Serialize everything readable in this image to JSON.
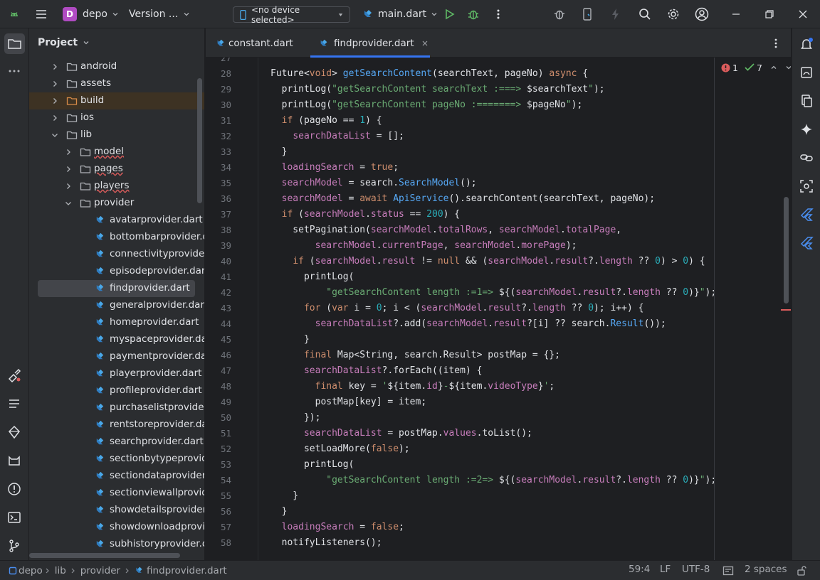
{
  "topbar": {
    "project_initial": "D",
    "project_name": "depo",
    "version_label": "Version ...",
    "device_selector": "<no device selected>",
    "run_config": "main.dart"
  },
  "sidebar": {
    "title": "Project"
  },
  "tree": [
    {
      "label": "android",
      "type": "folder",
      "indent": 0,
      "state": "closed"
    },
    {
      "label": "assets",
      "type": "folder",
      "indent": 0,
      "state": "closed"
    },
    {
      "label": "build",
      "type": "folder-excluded",
      "indent": 0,
      "state": "closed"
    },
    {
      "label": "ios",
      "type": "folder",
      "indent": 0,
      "state": "closed"
    },
    {
      "label": "lib",
      "type": "folder",
      "indent": 0,
      "state": "open"
    },
    {
      "label": "model",
      "type": "folder",
      "indent": 1,
      "state": "closed"
    },
    {
      "label": "pages",
      "type": "folder",
      "indent": 1,
      "state": "closed"
    },
    {
      "label": "players",
      "type": "folder",
      "indent": 1,
      "state": "closed"
    },
    {
      "label": "provider",
      "type": "folder",
      "indent": 1,
      "state": "open"
    },
    {
      "label": "avatarprovider.dart",
      "type": "file",
      "indent": 2
    },
    {
      "label": "bottombarprovider.dart",
      "type": "file",
      "indent": 2
    },
    {
      "label": "connectivityprovider.dart",
      "type": "file",
      "indent": 2
    },
    {
      "label": "episodeprovider.dart",
      "type": "file",
      "indent": 2
    },
    {
      "label": "findprovider.dart",
      "type": "file",
      "indent": 2,
      "selected": true
    },
    {
      "label": "generalprovider.dart",
      "type": "file",
      "indent": 2
    },
    {
      "label": "homeprovider.dart",
      "type": "file",
      "indent": 2
    },
    {
      "label": "myspaceprovider.dart",
      "type": "file",
      "indent": 2
    },
    {
      "label": "paymentprovider.dart",
      "type": "file",
      "indent": 2
    },
    {
      "label": "playerprovider.dart",
      "type": "file",
      "indent": 2
    },
    {
      "label": "profileprovider.dart",
      "type": "file",
      "indent": 2
    },
    {
      "label": "purchaselistprovider.dart",
      "type": "file",
      "indent": 2
    },
    {
      "label": "rentstoreprovider.dart",
      "type": "file",
      "indent": 2
    },
    {
      "label": "searchprovider.dart",
      "type": "file",
      "indent": 2
    },
    {
      "label": "sectionbytypeprovider.dart",
      "type": "file",
      "indent": 2
    },
    {
      "label": "sectiondataprovider.dart",
      "type": "file",
      "indent": 2
    },
    {
      "label": "sectionviewallprovider.dart",
      "type": "file",
      "indent": 2
    },
    {
      "label": "showdetailsprovider.dart",
      "type": "file",
      "indent": 2
    },
    {
      "label": "showdownloadprovider.dart",
      "type": "file",
      "indent": 2
    },
    {
      "label": "subhistoryprovider.dart",
      "type": "file",
      "indent": 2
    }
  ],
  "tabs": [
    {
      "label": "constant.dart",
      "active": false
    },
    {
      "label": "findprovider.dart",
      "active": true
    }
  ],
  "inspections": {
    "errors": "1",
    "warnings": "7"
  },
  "code_lines": [
    {
      "n": "27",
      "segs": []
    },
    {
      "n": "28",
      "segs": [
        [
          "t",
          "Future<"
        ],
        [
          "k",
          "void"
        ],
        [
          "t",
          "> "
        ],
        [
          "f",
          "getSearchContent"
        ],
        [
          "t",
          "(searchText, pageNo) "
        ],
        [
          "k",
          "async"
        ],
        [
          "t",
          " {"
        ]
      ]
    },
    {
      "n": "29",
      "segs": [
        [
          "t",
          "  printLog("
        ],
        [
          "s",
          "\"getSearchContent searchText :===> "
        ],
        [
          "t",
          "$searchText"
        ],
        [
          "s",
          "\""
        ],
        [
          "t",
          ");"
        ]
      ]
    },
    {
      "n": "30",
      "segs": [
        [
          "t",
          "  printLog("
        ],
        [
          "s",
          "\"getSearchContent pageNo :=======> "
        ],
        [
          "t",
          "$pageNo"
        ],
        [
          "s",
          "\""
        ],
        [
          "t",
          ");"
        ]
      ]
    },
    {
      "n": "31",
      "segs": [
        [
          "t",
          "  "
        ],
        [
          "k",
          "if"
        ],
        [
          "t",
          " (pageNo == "
        ],
        [
          "n",
          "1"
        ],
        [
          "t",
          ") {"
        ]
      ]
    },
    {
      "n": "32",
      "segs": [
        [
          "t",
          "    "
        ],
        [
          "p",
          "searchDataList"
        ],
        [
          "t",
          " = [];"
        ]
      ]
    },
    {
      "n": "33",
      "segs": [
        [
          "t",
          "  }"
        ]
      ]
    },
    {
      "n": "34",
      "segs": [
        [
          "t",
          "  "
        ],
        [
          "p",
          "loadingSearch"
        ],
        [
          "t",
          " = "
        ],
        [
          "k",
          "true"
        ],
        [
          "t",
          ";"
        ]
      ]
    },
    {
      "n": "35",
      "segs": [
        [
          "t",
          "  "
        ],
        [
          "p",
          "searchModel"
        ],
        [
          "t",
          " = search."
        ],
        [
          "f",
          "SearchModel"
        ],
        [
          "t",
          "();"
        ]
      ]
    },
    {
      "n": "36",
      "segs": [
        [
          "t",
          "  "
        ],
        [
          "p",
          "searchModel"
        ],
        [
          "t",
          " = "
        ],
        [
          "k",
          "await"
        ],
        [
          "t",
          " "
        ],
        [
          "f",
          "ApiService"
        ],
        [
          "t",
          "().searchContent(searchText, pageNo);"
        ]
      ]
    },
    {
      "n": "37",
      "segs": [
        [
          "t",
          "  "
        ],
        [
          "k",
          "if"
        ],
        [
          "t",
          " ("
        ],
        [
          "p",
          "searchModel"
        ],
        [
          "t",
          "."
        ],
        [
          "p",
          "status"
        ],
        [
          "t",
          " == "
        ],
        [
          "n",
          "200"
        ],
        [
          "t",
          ") {"
        ]
      ]
    },
    {
      "n": "38",
      "segs": [
        [
          "t",
          "    setPagination("
        ],
        [
          "p",
          "searchModel"
        ],
        [
          "t",
          "."
        ],
        [
          "p",
          "totalRows"
        ],
        [
          "t",
          ", "
        ],
        [
          "p",
          "searchModel"
        ],
        [
          "t",
          "."
        ],
        [
          "p",
          "totalPage"
        ],
        [
          "t",
          ","
        ]
      ]
    },
    {
      "n": "39",
      "segs": [
        [
          "t",
          "        "
        ],
        [
          "p",
          "searchModel"
        ],
        [
          "t",
          "."
        ],
        [
          "p",
          "currentPage"
        ],
        [
          "t",
          ", "
        ],
        [
          "p",
          "searchModel"
        ],
        [
          "t",
          "."
        ],
        [
          "p",
          "morePage"
        ],
        [
          "t",
          ");"
        ]
      ]
    },
    {
      "n": "40",
      "segs": [
        [
          "t",
          "    "
        ],
        [
          "k",
          "if"
        ],
        [
          "t",
          " ("
        ],
        [
          "p",
          "searchModel"
        ],
        [
          "t",
          "."
        ],
        [
          "p",
          "result"
        ],
        [
          "t",
          " != "
        ],
        [
          "k",
          "null"
        ],
        [
          "t",
          " && ("
        ],
        [
          "p",
          "searchModel"
        ],
        [
          "t",
          "."
        ],
        [
          "p",
          "result"
        ],
        [
          "t",
          "?."
        ],
        [
          "p",
          "length"
        ],
        [
          "t",
          " ?? "
        ],
        [
          "n",
          "0"
        ],
        [
          "t",
          ") > "
        ],
        [
          "n",
          "0"
        ],
        [
          "t",
          ") {"
        ]
      ]
    },
    {
      "n": "41",
      "segs": [
        [
          "t",
          "      printLog("
        ]
      ]
    },
    {
      "n": "42",
      "segs": [
        [
          "t",
          "          "
        ],
        [
          "s",
          "\"getSearchContent length :=1=> "
        ],
        [
          "t",
          "${("
        ],
        [
          "p",
          "searchModel"
        ],
        [
          "t",
          "."
        ],
        [
          "p",
          "result"
        ],
        [
          "t",
          "?."
        ],
        [
          "p",
          "length"
        ],
        [
          "t",
          " ?? "
        ],
        [
          "n",
          "0"
        ],
        [
          "t",
          ")}"
        ],
        [
          "s",
          "\""
        ],
        [
          "t",
          ");"
        ]
      ]
    },
    {
      "n": "43",
      "segs": [
        [
          "t",
          "      "
        ],
        [
          "k",
          "for"
        ],
        [
          "t",
          " ("
        ],
        [
          "k",
          "var"
        ],
        [
          "t",
          " i = "
        ],
        [
          "n",
          "0"
        ],
        [
          "t",
          "; i < ("
        ],
        [
          "p",
          "searchModel"
        ],
        [
          "t",
          "."
        ],
        [
          "p",
          "result"
        ],
        [
          "t",
          "?."
        ],
        [
          "p",
          "length"
        ],
        [
          "t",
          " ?? "
        ],
        [
          "n",
          "0"
        ],
        [
          "t",
          "); i++) {"
        ]
      ]
    },
    {
      "n": "44",
      "segs": [
        [
          "t",
          "        "
        ],
        [
          "p",
          "searchDataList"
        ],
        [
          "t",
          "?.add("
        ],
        [
          "p",
          "searchModel"
        ],
        [
          "t",
          "."
        ],
        [
          "p",
          "result"
        ],
        [
          "t",
          "?[i] ?? search."
        ],
        [
          "f",
          "Result"
        ],
        [
          "t",
          "());"
        ]
      ]
    },
    {
      "n": "45",
      "segs": [
        [
          "t",
          "      }"
        ]
      ]
    },
    {
      "n": "46",
      "segs": [
        [
          "t",
          "      "
        ],
        [
          "k",
          "final"
        ],
        [
          "t",
          " Map<String, search.Result> postMap = {};"
        ]
      ]
    },
    {
      "n": "47",
      "segs": [
        [
          "t",
          "      "
        ],
        [
          "p",
          "searchDataList"
        ],
        [
          "t",
          "?.forEach((item) {"
        ]
      ]
    },
    {
      "n": "48",
      "segs": [
        [
          "t",
          "        "
        ],
        [
          "k",
          "final"
        ],
        [
          "t",
          " key = "
        ],
        [
          "s",
          "'"
        ],
        [
          "t",
          "${item."
        ],
        [
          "p",
          "id"
        ],
        [
          "t",
          "}"
        ],
        [
          "s",
          "-"
        ],
        [
          "t",
          "${item."
        ],
        [
          "p",
          "videoType"
        ],
        [
          "t",
          "}"
        ],
        [
          "s",
          "'"
        ],
        [
          "t",
          ";"
        ]
      ]
    },
    {
      "n": "49",
      "segs": [
        [
          "t",
          "        postMap[key] = item;"
        ]
      ]
    },
    {
      "n": "50",
      "segs": [
        [
          "t",
          "      });"
        ]
      ]
    },
    {
      "n": "51",
      "segs": [
        [
          "t",
          "      "
        ],
        [
          "p",
          "searchDataList"
        ],
        [
          "t",
          " = postMap."
        ],
        [
          "p",
          "values"
        ],
        [
          "t",
          ".toList();"
        ]
      ]
    },
    {
      "n": "52",
      "segs": [
        [
          "t",
          "      setLoadMore("
        ],
        [
          "k",
          "false"
        ],
        [
          "t",
          ");"
        ]
      ]
    },
    {
      "n": "53",
      "segs": [
        [
          "t",
          "      printLog("
        ]
      ]
    },
    {
      "n": "54",
      "segs": [
        [
          "t",
          "          "
        ],
        [
          "s",
          "\"getSearchContent length :=2=> "
        ],
        [
          "t",
          "${("
        ],
        [
          "p",
          "searchModel"
        ],
        [
          "t",
          "."
        ],
        [
          "p",
          "result"
        ],
        [
          "t",
          "?."
        ],
        [
          "p",
          "length"
        ],
        [
          "t",
          " ?? "
        ],
        [
          "n",
          "0"
        ],
        [
          "t",
          ")}"
        ],
        [
          "s",
          "\""
        ],
        [
          "t",
          ");"
        ]
      ]
    },
    {
      "n": "55",
      "segs": [
        [
          "t",
          "    }"
        ]
      ]
    },
    {
      "n": "56",
      "segs": [
        [
          "t",
          "  }"
        ]
      ]
    },
    {
      "n": "57",
      "segs": [
        [
          "t",
          "  "
        ],
        [
          "p",
          "loadingSearch"
        ],
        [
          "t",
          " = "
        ],
        [
          "k",
          "false"
        ],
        [
          "t",
          ";"
        ]
      ]
    },
    {
      "n": "58",
      "segs": [
        [
          "t",
          "  notifyListeners();"
        ]
      ]
    }
  ],
  "statusbar": {
    "crumbs": [
      "depo",
      "lib",
      "provider",
      "findprovider.dart"
    ],
    "position": "59:4",
    "line_sep": "LF",
    "encoding": "UTF-8",
    "indent": "2 spaces"
  },
  "colors": {
    "accent": "#3574f0",
    "error": "#db5c5c",
    "warning_ok": "#5fb865",
    "dart_blue": "#4aa8e8",
    "project_badge": "#b04bc2",
    "run_green": "#5fb865"
  }
}
